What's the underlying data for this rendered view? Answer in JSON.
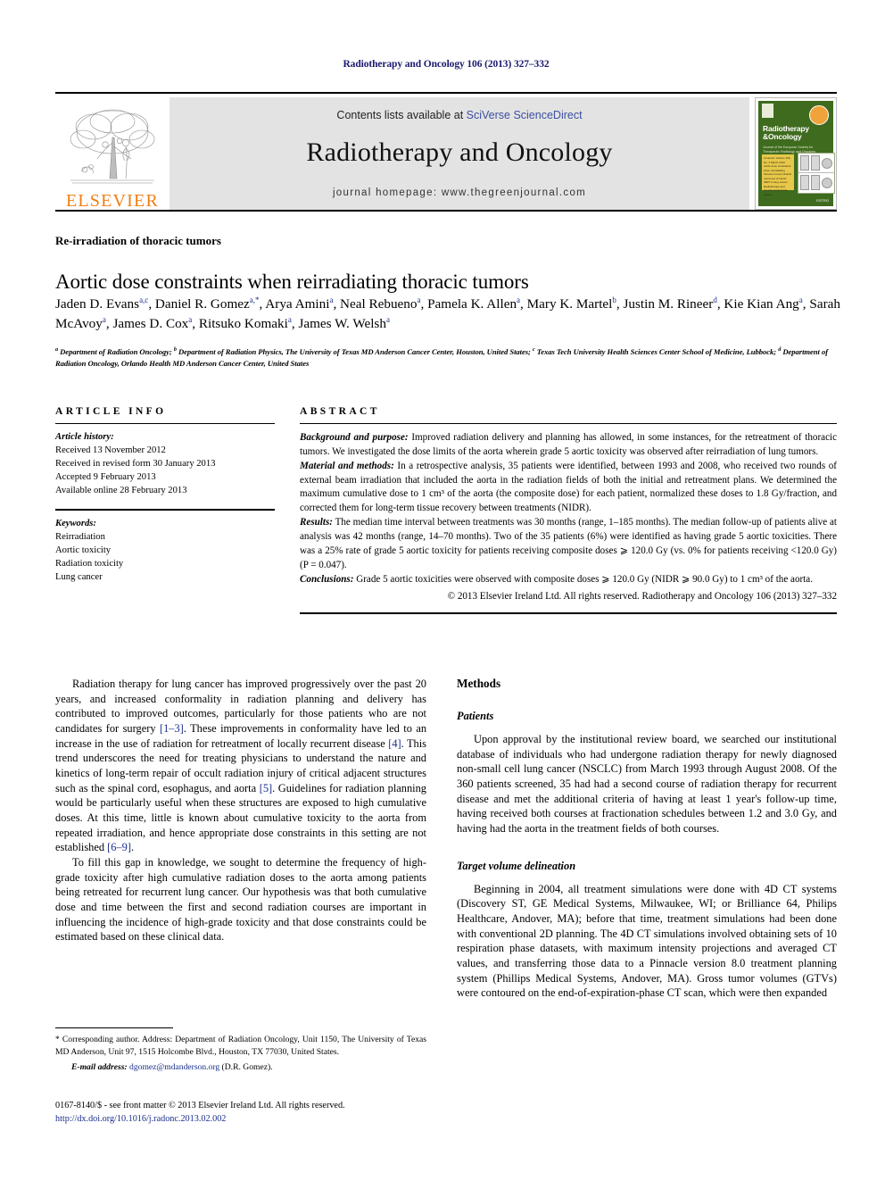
{
  "running_head": "Radiotherapy and Oncology 106 (2013) 327–332",
  "masthead": {
    "contents_prefix": "Contents lists available at ",
    "contents_link": "SciVerse ScienceDirect",
    "journal_name": "Radiotherapy and Oncology",
    "homepage_prefix": "journal homepage: ",
    "homepage_url": "www.thegreenjournal.com",
    "publisher_wordmark": "ELSEVIER"
  },
  "cover": {
    "title_line1": "Radiotherapy",
    "title_line2": "&Oncology",
    "subtitle": "Journal of the European Society for Therapeutic Radiology and Oncology",
    "toc_lines": "Contents: Volume 106, No. 3\nMarch 2013\n\nAortic dose constraints when reirradiating thoracic tumors\n\nClinical outcomes of hybrid IMRT\nin lung cancer\n\nRadiotherapy and special needs\nstudy update",
    "footer_logo": "ESTRO"
  },
  "section_label": "Re-irradiation of thoracic tumors",
  "article_title": "Aortic dose constraints when reirradiating thoracic tumors",
  "authors": [
    {
      "name": "Jaden D. Evans",
      "sup": "a,c"
    },
    {
      "name": "Daniel R. Gomez",
      "sup": "a,*"
    },
    {
      "name": "Arya Amini",
      "sup": "a"
    },
    {
      "name": "Neal Rebueno",
      "sup": "a"
    },
    {
      "name": "Pamela K. Allen",
      "sup": "a"
    },
    {
      "name": "Mary K. Martel",
      "sup": "b"
    },
    {
      "name": "Justin M. Rineer",
      "sup": "d"
    },
    {
      "name": "Kie Kian Ang",
      "sup": "a"
    },
    {
      "name": "Sarah McAvoy",
      "sup": "a"
    },
    {
      "name": "James D. Cox",
      "sup": "a"
    },
    {
      "name": "Ritsuko Komaki",
      "sup": "a"
    },
    {
      "name": "James W. Welsh",
      "sup": "a"
    }
  ],
  "affiliations": [
    {
      "sup": "a",
      "text": "Department of Radiation Oncology;"
    },
    {
      "sup": "b",
      "text": "Department of Radiation Physics, The University of Texas MD Anderson Cancer Center, Houston, United States;"
    },
    {
      "sup": "c",
      "text": "Texas Tech University Health Sciences Center School of Medicine, Lubbock;"
    },
    {
      "sup": "d",
      "text": "Department of Radiation Oncology, Orlando Health MD Anderson Cancer Center, United States"
    }
  ],
  "article_info": {
    "heading": "ARTICLE INFO",
    "history_label": "Article history:",
    "history": [
      "Received 13 November 2012",
      "Received in revised form 30 January 2013",
      "Accepted 9 February 2013",
      "Available online 28 February 2013"
    ],
    "keywords_label": "Keywords:",
    "keywords": [
      "Reirradiation",
      "Aortic toxicity",
      "Radiation toxicity",
      "Lung cancer"
    ]
  },
  "abstract": {
    "heading": "ABSTRACT",
    "background_label": "Background and purpose:",
    "background_text": " Improved radiation delivery and planning has allowed, in some instances, for the retreatment of thoracic tumors. We investigated the dose limits of the aorta wherein grade 5 aortic toxicity was observed after reirradiation of lung tumors.",
    "methods_label": "Material and methods:",
    "methods_text": " In a retrospective analysis, 35 patients were identified, between 1993 and 2008, who received two rounds of external beam irradiation that included the aorta in the radiation fields of both the initial and retreatment plans. We determined the maximum cumulative dose to 1 cm³ of the aorta (the composite dose) for each patient, normalized these doses to 1.8 Gy/fraction, and corrected them for long-term tissue recovery between treatments (NIDR).",
    "results_label": "Results:",
    "results_text": " The median time interval between treatments was 30 months (range, 1–185 months). The median follow-up of patients alive at analysis was 42 months (range, 14–70 months). Two of the 35 patients (6%) were identified as having grade 5 aortic toxicities. There was a 25% rate of grade 5 aortic toxicity for patients receiving composite doses ⩾ 120.0 Gy (vs. 0% for patients receiving <120.0 Gy) (P = 0.047).",
    "conclusions_label": "Conclusions:",
    "conclusions_text": " Grade 5 aortic toxicities were observed with composite doses ⩾ 120.0 Gy (NIDR ⩾ 90.0 Gy) to 1 cm³ of the aorta.",
    "copyright": "© 2013 Elsevier Ireland Ltd. All rights reserved. Radiotherapy and Oncology 106 (2013) 327–332"
  },
  "body": {
    "intro_p1": "Radiation therapy for lung cancer has improved progressively over the past 20 years, and increased conformality in radiation planning and delivery has contributed to improved outcomes, particularly for those patients who are not candidates for surgery [1–3]. These improvements in conformality have led to an increase in the use of radiation for retreatment of locally recurrent disease [4]. This trend underscores the need for treating physicians to understand the nature and kinetics of long-term repair of occult radiation injury of critical adjacent structures such as the spinal cord, esophagus, and aorta [5]. Guidelines for radiation planning would be particularly useful when these structures are exposed to high cumulative doses. At this time, little is known about cumulative toxicity to the aorta from repeated irradiation, and hence appropriate dose constraints in this setting are not established [6–9].",
    "intro_p2": "To fill this gap in knowledge, we sought to determine the frequency of high-grade toxicity after high cumulative radiation doses to the aorta among patients being retreated for recurrent lung cancer. Our hypothesis was that both cumulative dose and time between the first and second radiation courses are important in influencing the incidence of high-grade toxicity and that dose constraints could be estimated based on these clinical data.",
    "methods_heading": "Methods",
    "patients_heading": "Patients",
    "patients_p1": "Upon approval by the institutional review board, we searched our institutional database of individuals who had undergone radiation therapy for newly diagnosed non-small cell lung cancer (NSCLC) from March 1993 through August 2008. Of the 360 patients screened, 35 had had a second course of radiation therapy for recurrent disease and met the additional criteria of having at least 1 year's follow-up time, having received both courses at fractionation schedules between 1.2 and 3.0 Gy, and having had the aorta in the treatment fields of both courses.",
    "target_heading": "Target volume delineation",
    "target_p1": "Beginning in 2004, all treatment simulations were done with 4D CT systems (Discovery ST, GE Medical Systems, Milwaukee, WI; or Brilliance 64, Philips Healthcare, Andover, MA); before that time, treatment simulations had been done with conventional 2D planning. The 4D CT simulations involved obtaining sets of 10 respiration phase datasets, with maximum intensity projections and averaged CT values, and transferring those data to a Pinnacle version 8.0 treatment planning system (Phillips Medical Systems, Andover, MA). Gross tumor volumes (GTVs) were contoured on the end-of-expiration-phase CT scan, which were then expanded"
  },
  "footnotes": {
    "corresponding": "* Corresponding author. Address: Department of Radiation Oncology, Unit 1150, The University of Texas MD Anderson, Unit 97, 1515 Holcombe Blvd., Houston, TX 77030, United States.",
    "email_label": "E-mail address:",
    "email": "dgomez@mdanderson.org",
    "email_suffix": " (D.R. Gomez)."
  },
  "footer": {
    "issn_line": "0167-8140/$ - see front matter © 2013 Elsevier Ireland Ltd. All rights reserved.",
    "doi": "http://dx.doi.org/10.1016/j.radonc.2013.02.002"
  },
  "colors": {
    "link_blue": "#3d4fa1",
    "ref_blue": "#1a2f8a",
    "elsevier_orange": "#f07e13",
    "cover_green": "#3f6b1e",
    "panel_grey": "#e3e3e3"
  }
}
